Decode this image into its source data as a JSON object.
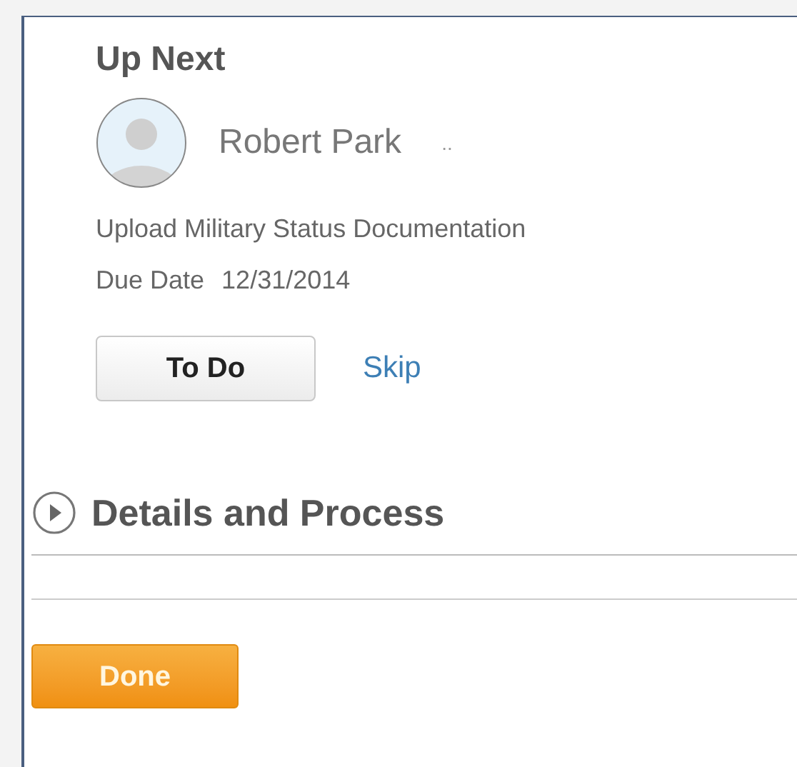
{
  "up_next": {
    "title": "Up Next",
    "person": {
      "name": "Robert Park",
      "more": ".."
    },
    "task": "Upload Military Status Documentation",
    "due_label": "Due Date",
    "due_date": "12/31/2014",
    "buttons": [
      {
        "kind": "primary",
        "label": "To Do"
      },
      {
        "kind": "link",
        "label": "Skip"
      }
    ]
  },
  "section": {
    "title": "Details and Process",
    "expanded": false
  },
  "footer_button": {
    "label": "Done"
  }
}
